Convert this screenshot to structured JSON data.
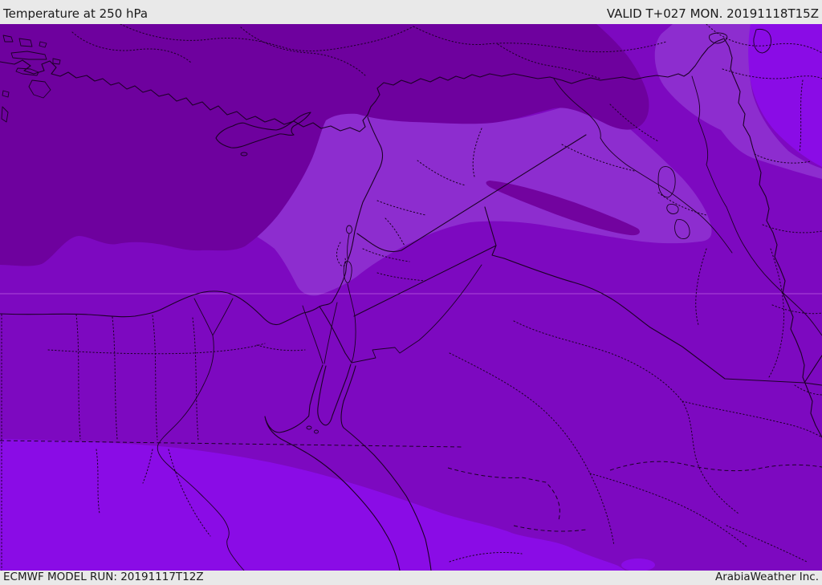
{
  "header": {
    "title": "Temperature at 250 hPa",
    "validity": "VALID T+027 MON. 20191118T15Z"
  },
  "footer": {
    "model_run": "ECMWF MODEL RUN: 20191117T12Z",
    "credit": "ArabiaWeather Inc."
  },
  "palette": {
    "bar_bg": "#e9e9e9",
    "bar_text": "#1b1b1b",
    "shade_dark": "#6e019e",
    "shade_medium": "#7d09c0",
    "shade_light": "#8d2dcf",
    "shade_bright": "#8a0ce6",
    "shade_lens": "#72039f",
    "border_line": "#1c0126"
  }
}
